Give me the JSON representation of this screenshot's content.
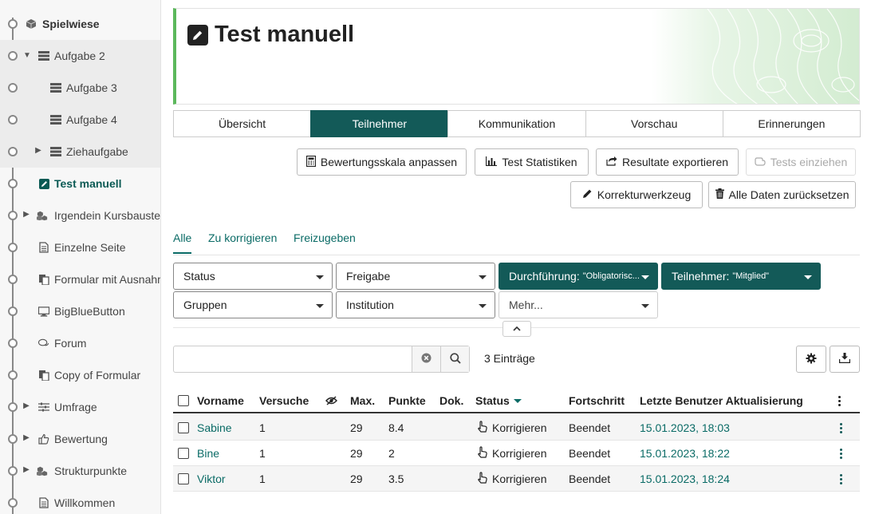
{
  "sidebar": {
    "items": [
      {
        "label": "Spielwiese",
        "icon": "cube-icon",
        "style": "bold"
      },
      {
        "label": "Aufgabe 2",
        "icon": "tasks-icon",
        "twisty": "expanded"
      },
      {
        "label": "Aufgabe 3",
        "icon": "tasks-icon"
      },
      {
        "label": "Aufgabe 4",
        "icon": "tasks-icon"
      },
      {
        "label": "Ziehaufgabe",
        "icon": "tasks-icon",
        "twisty": "collapsed"
      },
      {
        "label": "Test manuell",
        "icon": "edit-icon",
        "style": "active"
      },
      {
        "label": "Irgendein Kursbaustein",
        "icon": "cubes-icon",
        "twisty": "collapsed"
      },
      {
        "label": "Einzelne Seite",
        "icon": "file-icon"
      },
      {
        "label": "Formular mit Ausnahme",
        "icon": "copy-icon"
      },
      {
        "label": "BigBlueButton",
        "icon": "monitor-icon"
      },
      {
        "label": "Forum",
        "icon": "comments-icon"
      },
      {
        "label": "Copy of Formular",
        "icon": "copy-icon"
      },
      {
        "label": "Umfrage",
        "icon": "sliders-icon",
        "twisty": "collapsed"
      },
      {
        "label": "Bewertung",
        "icon": "thumbs-up-icon",
        "twisty": "collapsed"
      },
      {
        "label": "Strukturpunkte",
        "icon": "cubes-icon",
        "twisty": "collapsed"
      },
      {
        "label": "Willkommen",
        "icon": "file-icon"
      }
    ]
  },
  "header": {
    "title": "Test manuell",
    "icon": "edit-icon",
    "accent": "#5cb85c"
  },
  "tabs": [
    {
      "label": "Übersicht"
    },
    {
      "label": "Teilnehmer",
      "active": true
    },
    {
      "label": "Kommunikation"
    },
    {
      "label": "Vorschau"
    },
    {
      "label": "Erinnerungen"
    }
  ],
  "toolbar": {
    "grading_scale": "Bewertungsskala anpassen",
    "test_statistics": "Test Statistiken",
    "export_results": "Resultate exportieren",
    "pull_tests": "Tests einziehen",
    "correction_tool": "Korrekturwerkzeug",
    "reset_data": "Alle Daten zurücksetzen"
  },
  "subtabs": [
    {
      "label": "Alle",
      "active": true
    },
    {
      "label": "Zu korrigieren"
    },
    {
      "label": "Freizugeben"
    }
  ],
  "filters": {
    "status": "Status",
    "release": "Freigabe",
    "execution_label": "Durchführung:",
    "execution_value": "\"Obligatorisc...",
    "participant_label": "Teilnehmer:",
    "participant_value": "\"Mitglied\"",
    "groups": "Gruppen",
    "institution": "Institution",
    "more": "Mehr..."
  },
  "search": {
    "value": "",
    "placeholder": ""
  },
  "entries_count": "3 Einträge",
  "table": {
    "headers": {
      "firstname": "Vorname",
      "attempts": "Versuche",
      "max": "Max.",
      "points": "Punkte",
      "doc": "Dok.",
      "status": "Status",
      "progress": "Fortschritt",
      "last_update": "Letzte Benutzer Aktualisierung"
    },
    "rows": [
      {
        "firstname": "Sabine",
        "attempts": "1",
        "max": "29",
        "points": "8.4",
        "status": "Korrigieren",
        "progress": "Beendet",
        "date": "15.01.2023",
        "time": "18:03"
      },
      {
        "firstname": "Bine",
        "attempts": "1",
        "max": "29",
        "points": "2",
        "status": "Korrigieren",
        "progress": "Beendet",
        "date": "15.01.2023",
        "time": "18:22"
      },
      {
        "firstname": "Viktor",
        "attempts": "1",
        "max": "29",
        "points": "3.5",
        "status": "Korrigieren",
        "progress": "Beendet",
        "date": "15.01.2023",
        "time": "18:24"
      }
    ]
  },
  "colors": {
    "primary": "#135a58",
    "link": "#0a6b66",
    "accent": "#5cb85c"
  }
}
